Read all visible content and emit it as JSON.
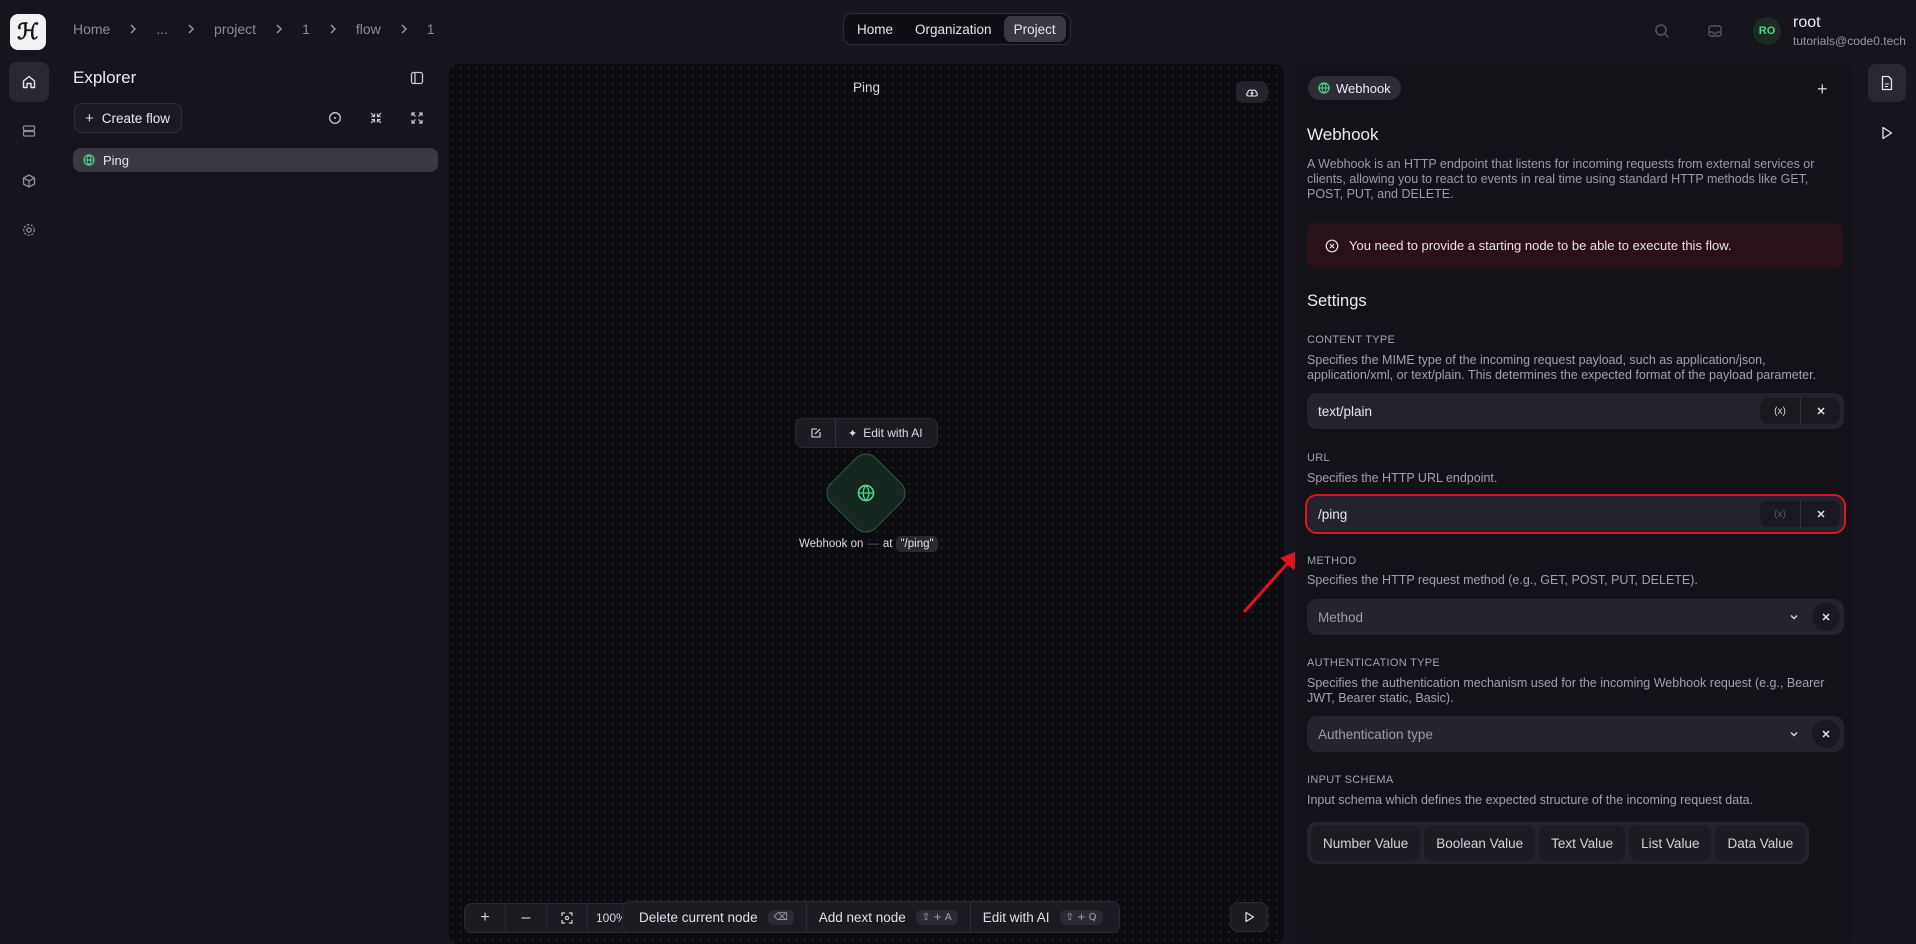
{
  "breadcrumb": [
    "Home",
    "...",
    "project",
    "1",
    "flow",
    "1"
  ],
  "top_nav": {
    "tabs": [
      "Home",
      "Organization",
      "Project"
    ],
    "active": "Project"
  },
  "user": {
    "initials": "RO",
    "name": "root",
    "email": "tutorials@code0.tech"
  },
  "explorer": {
    "title": "Explorer",
    "create_label": "Create flow",
    "flows": [
      {
        "name": "Ping",
        "icon": "globe-icon"
      }
    ]
  },
  "canvas": {
    "title": "Ping",
    "node_toolbar": {
      "ai_label": "Edit with AI"
    },
    "node": {
      "label_prefix": "Webhook on",
      "label_dim": "—",
      "label_at": "at",
      "path": "\"/ping\""
    },
    "zoom": {
      "plus": "+",
      "minus": "–",
      "percent": "100%"
    },
    "actions": [
      {
        "label": "Delete current node",
        "kbd": "⌫"
      },
      {
        "label": "Add next node",
        "kbd": "⇧ + A"
      },
      {
        "label": "Edit with AI",
        "kbd": "⇧ + Q"
      }
    ]
  },
  "panel": {
    "chip": "Webhook",
    "add": "+",
    "title": "Webhook",
    "description": "A Webhook is an HTTP endpoint that listens for incoming requests from external services or clients, allowing you to react to events in real time using standard HTTP methods like GET, POST, PUT, and DELETE.",
    "alert": "You need to provide a starting node to be able to execute this flow.",
    "settings_title": "Settings",
    "content_type": {
      "label": "CONTENT TYPE",
      "desc": "Specifies the MIME type of the incoming request payload, such as application/json, application/xml, or text/plain. This determines the expected format of the payload parameter.",
      "value": "text/plain"
    },
    "url": {
      "label": "URL",
      "desc": "Specifies the HTTP URL endpoint.",
      "value": "/ping"
    },
    "method": {
      "label": "METHOD",
      "desc": "Specifies the HTTP request method (e.g., GET, POST, PUT, DELETE).",
      "placeholder": "Method"
    },
    "auth": {
      "label": "AUTHENTICATION TYPE",
      "desc": "Specifies the authentication mechanism used for the incoming Webhook request (e.g., Bearer JWT, Bearer static, Basic).",
      "placeholder": "Authentication type"
    },
    "schema": {
      "label": "INPUT SCHEMA",
      "desc": "Input schema which defines the expected structure of the incoming request data.",
      "buttons": [
        "Number Value",
        "Boolean Value",
        "Text Value",
        "List Value",
        "Data Value"
      ]
    },
    "var_glyph": "(x)"
  },
  "colors": {
    "accent_green": "#4fd58b",
    "highlight_red": "#e0141e",
    "alert_bg": "#2a1019"
  }
}
